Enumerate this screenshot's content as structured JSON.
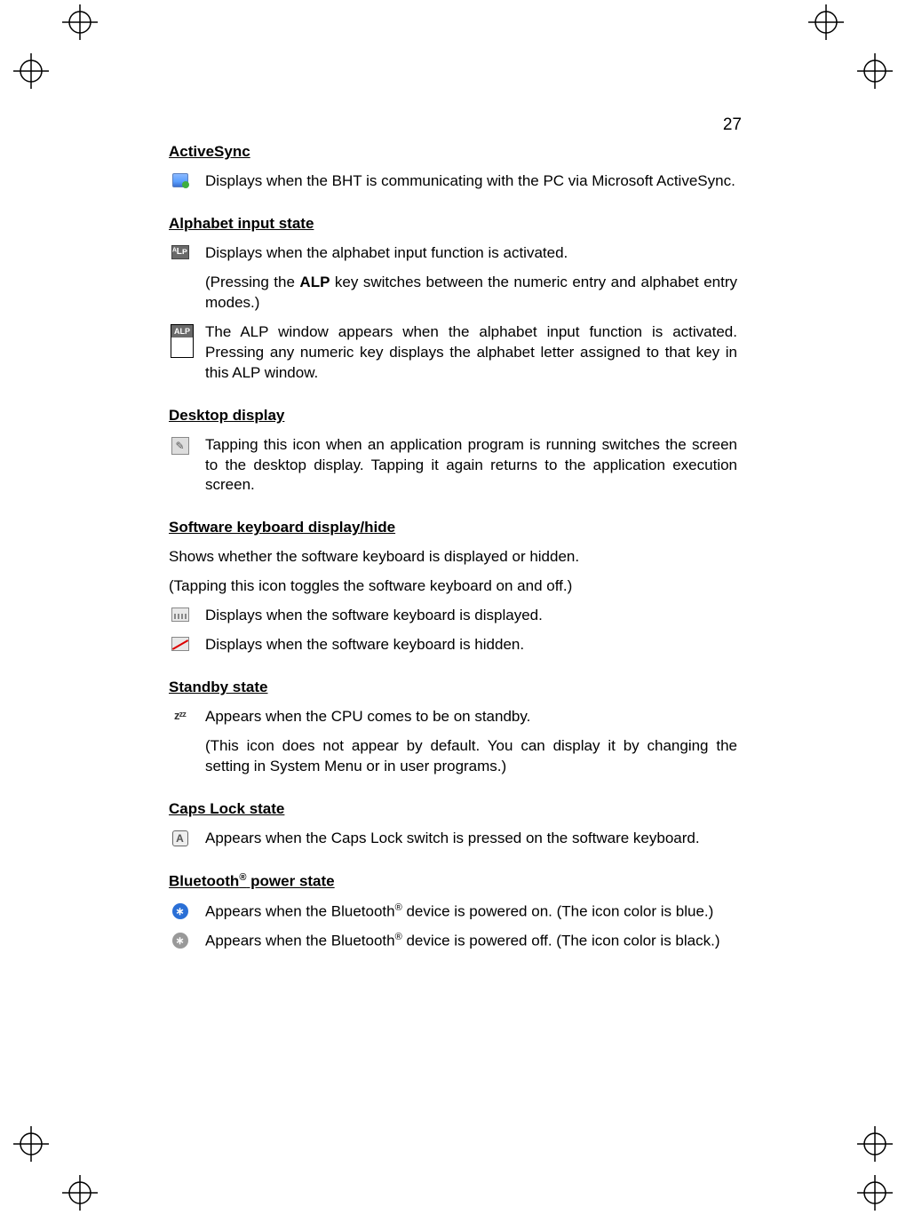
{
  "page_number": "27",
  "sections": {
    "activesync": {
      "heading": "ActiveSync",
      "desc": "Displays when the BHT is communicating with the PC via Microsoft ActiveSync."
    },
    "alphabet_input": {
      "heading": "Alphabet input state",
      "line1": "Displays when the alphabet input function is activated.",
      "line2_pre": "(Pressing the ",
      "line2_bold": "ALP",
      "line2_post": " key switches between the numeric entry and alphabet entry modes.)",
      "alp_label": "ALP",
      "line3": "The ALP window appears when the alphabet input function is activated. Pressing any numeric key displays the alphabet letter assigned to that key in this ALP window."
    },
    "desktop": {
      "heading": "Desktop display",
      "desc": "Tapping this icon when an application program is running switches the screen to the desktop display. Tapping it again returns to the application execution screen."
    },
    "softkbd": {
      "heading": "Software keyboard display/hide",
      "intro1": "Shows whether the software keyboard is displayed or hidden.",
      "intro2": "(Tapping this icon toggles the software keyboard on and off.)",
      "shown": "Displays when the software keyboard is displayed.",
      "hidden": "Displays when the software keyboard is hidden."
    },
    "standby": {
      "heading": "Standby state",
      "line1": "Appears when the CPU comes to be on standby.",
      "line2": "(This icon does not appear by default. You can display it by changing the setting in System Menu or in user programs.)"
    },
    "capslock": {
      "heading": "Caps Lock state",
      "desc": "Appears when the Caps Lock switch is pressed on the software keyboard."
    },
    "bluetooth": {
      "heading_pre": "Bluetooth",
      "heading_sup": "®",
      "heading_post": " power state",
      "on_pre": "Appears when the Bluetooth",
      "on_post": " device is powered on. (The icon color is blue.)",
      "off_pre": "Appears when the Bluetooth",
      "off_post": " device is powered off. (The icon color is black.)"
    }
  },
  "icon_text": {
    "alp_small": "ᴬLᴘ",
    "alp_hdr": "ALP",
    "bt_glyph": "∗",
    "caps_glyph": "A",
    "desktop_glyph": "✎",
    "standby_glyph": "zᶻᶻ"
  }
}
